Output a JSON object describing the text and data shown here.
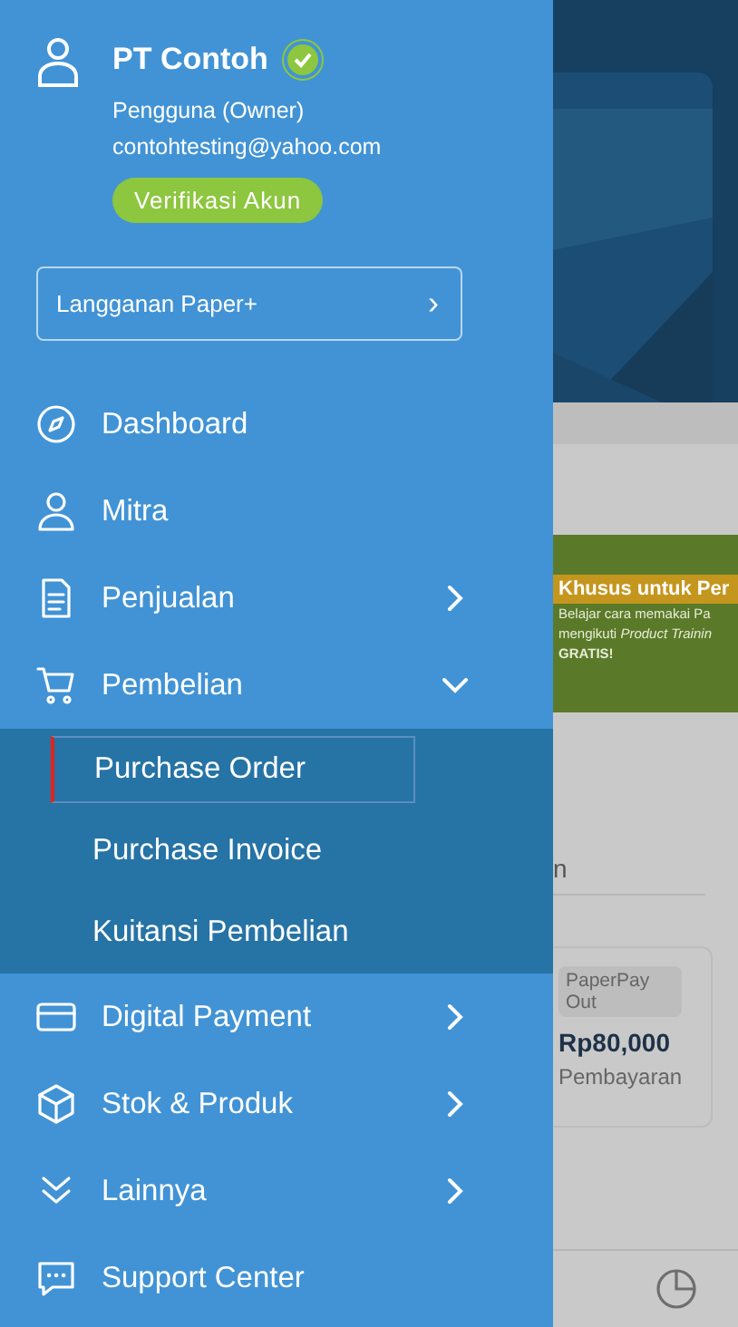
{
  "profile": {
    "name": "PT Contoh",
    "verified": true,
    "role": "Pengguna (Owner)",
    "email": "contohtesting@yahoo.com",
    "verify_button": "Verifikasi Akun"
  },
  "subscription": {
    "label": "Langganan Paper+",
    "arrow": "›"
  },
  "menu": [
    {
      "label": "Dashboard",
      "kind": "link"
    },
    {
      "label": "Mitra",
      "kind": "link"
    },
    {
      "label": "Penjualan",
      "kind": "group",
      "expanded": false
    },
    {
      "label": "Pembelian",
      "kind": "group",
      "expanded": true,
      "children": [
        {
          "label": "Purchase Order",
          "selected": true
        },
        {
          "label": "Purchase Invoice",
          "selected": false
        },
        {
          "label": "Kuitansi Pembelian",
          "selected": false
        }
      ]
    },
    {
      "label": "Digital Payment",
      "kind": "group",
      "expanded": false
    },
    {
      "label": "Stok & Produk",
      "kind": "group",
      "expanded": false
    },
    {
      "label": "Lainnya",
      "kind": "group",
      "expanded": false
    },
    {
      "label": "Support Center",
      "kind": "link"
    }
  ],
  "background": {
    "banner_title": "Khusus untuk Per",
    "banner_lines": [
      "Belajar cara memakai Pa",
      "mengikuti *Product Trainin*",
      "**GRATIS!**"
    ],
    "section_tail": "n",
    "card": {
      "tag": "PaperPay Out",
      "amount": "Rp80,000",
      "caption": "Pembayaran"
    }
  }
}
